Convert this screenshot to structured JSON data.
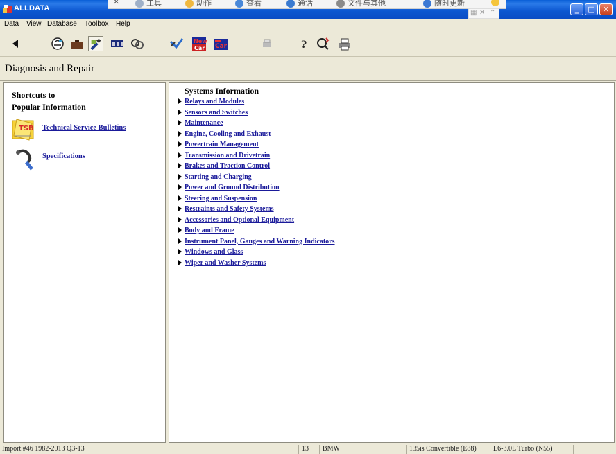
{
  "titlebar": {
    "title": "ALLDATA",
    "overlay_items": [
      "工具",
      "动作",
      "查看",
      "通话",
      "文件与其他",
      "随时更新"
    ],
    "min_glyph": "_",
    "max_glyph": "□",
    "close_glyph": "✕"
  },
  "menu": {
    "items": [
      "Data",
      "View",
      "Database",
      "Toolbox",
      "Help"
    ]
  },
  "toolbar": {
    "buttons": [
      "back-icon",
      "vehicle-selection-icon",
      "component-locator-icon",
      "diagnosis-repair-icon",
      "specifications-icon",
      "procedures-icon",
      "repair-tools-icon",
      "new-car-icon",
      "car-repair-icon",
      "print-icon",
      "help-icon",
      "search-icon",
      "printer-icon"
    ]
  },
  "page": {
    "title": "Diagnosis and Repair"
  },
  "shortcuts": {
    "heading_line1": "Shortcuts to",
    "heading_line2": "Popular Information",
    "tsb_label": "Technical Service Bulletins",
    "tsb_badge": "TSB",
    "specs_label": "Specifications"
  },
  "systems": {
    "title": "Systems Information",
    "items": [
      "Relays and Modules",
      "Sensors and Switches",
      "Maintenance",
      "Engine, Cooling and Exhaust",
      "Powertrain Management",
      "Transmission and Drivetrain",
      "Brakes and Traction Control",
      "Starting and Charging",
      "Power and Ground Distribution",
      "Steering and Suspension",
      "Restraints and Safety Systems",
      "Accessories and Optional Equipment",
      "Body and Frame",
      "Instrument Panel, Gauges and Warning Indicators",
      "Windows and Glass",
      "Wiper and Washer Systems"
    ]
  },
  "status": {
    "import": "Import #46 1982-2013 Q3-13",
    "count": "13",
    "make": "BMW",
    "model": "135is Convertible (E88)",
    "engine": "L6-3.0L Turbo (N55)"
  },
  "colors": {
    "link": "#1a1a9a",
    "titlebar": "#0a56d0",
    "chrome": "#ece9d8"
  }
}
